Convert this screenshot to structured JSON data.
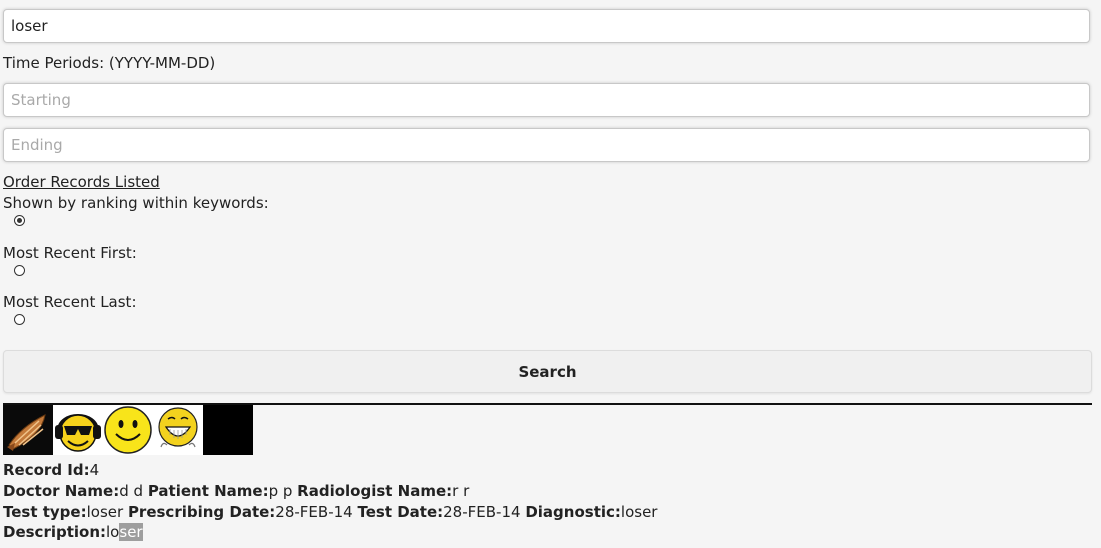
{
  "search": {
    "keywords_value": "loser",
    "time_periods_label": "Time Periods: (YYYY-MM-DD)",
    "starting_placeholder": "Starting",
    "ending_placeholder": "Ending",
    "order_link": "Order Records Listed",
    "options": [
      {
        "label": "Shown by ranking within keywords:",
        "checked": true
      },
      {
        "label": "Most Recent First:",
        "checked": false
      },
      {
        "label": "Most Recent Last:",
        "checked": false
      }
    ],
    "search_button": "Search"
  },
  "thumbnails": [
    "shell-icon",
    "headphones-smiley-icon",
    "smiley-icon",
    "grinning-smiley-icon",
    "black-image"
  ],
  "record": {
    "record_id_label": "Record Id:",
    "record_id": "4",
    "doctor_label": "Doctor Name:",
    "doctor": "d d",
    "patient_label": "Patient Name:",
    "patient": "p p",
    "radiologist_label": "Radiologist Name:",
    "radiologist": "r r",
    "test_type_label": "Test type:",
    "test_type": "loser",
    "prescribing_label": "Prescribing Date:",
    "prescribing_date": "28-FEB-14",
    "test_date_label": "Test Date:",
    "test_date": "28-FEB-14",
    "diagnostic_label": "Diagnostic:",
    "diagnostic": "loser",
    "description_label": "Description:",
    "description_plain": "lo",
    "description_highlight": "ser"
  },
  "colors": {
    "background": "#f5f5f5",
    "highlight": "#9e9e9e",
    "divider": "#111111"
  }
}
